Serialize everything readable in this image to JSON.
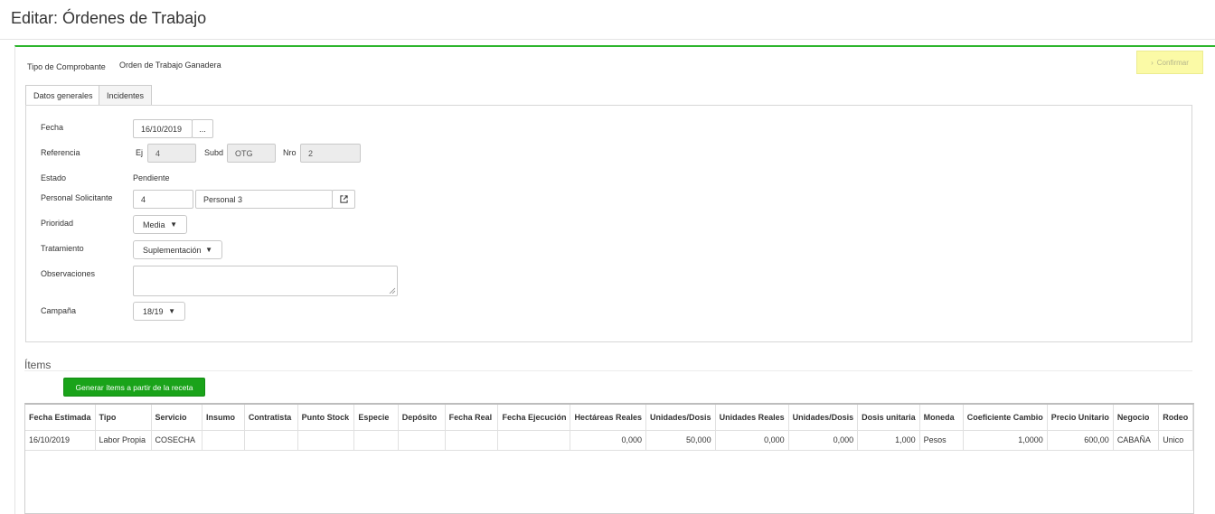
{
  "header": {
    "title": "Editar: Órdenes de Trabajo"
  },
  "form": {
    "tipo_label": "Tipo de Comprobante",
    "tipo_value": "Orden de Trabajo Ganadera",
    "confirm_label": "Confirmar",
    "tabs": [
      {
        "label": "Datos generales"
      },
      {
        "label": "Incidentes"
      }
    ],
    "fecha_label": "Fecha",
    "fecha_value": "16/10/2019",
    "fecha_btn": "...",
    "referencia_label": "Referencia",
    "ej_label": "Ej",
    "ej_value": "4",
    "subd_label": "Subd",
    "subd_value": "OTG",
    "nro_label": "Nro",
    "nro_value": "2",
    "estado_label": "Estado",
    "estado_value": "Pendiente",
    "personal_label": "Personal Solicitante",
    "personal_code": "4",
    "personal_name": "Personal 3",
    "prioridad_label": "Prioridad",
    "prioridad_value": "Media",
    "tratamiento_label": "Tratamiento",
    "tratamiento_value": "Suplementación",
    "observaciones_label": "Observaciones",
    "observaciones_value": "",
    "campana_label": "Campaña",
    "campana_value": "18/19"
  },
  "items": {
    "title": "Ítems",
    "generate_label": "Generar ítems a partir de la receta",
    "columns": [
      "Fecha Estimada",
      "Tipo",
      "Servicio",
      "Insumo",
      "Contratista",
      "Punto Stock",
      "Especie",
      "Depósito",
      "Fecha Real",
      "Fecha Ejecución",
      "Hectáreas Reales",
      "Unidades/Dosis",
      "Unidades Reales",
      "Unidades/Dosis",
      "Dosis unitaria",
      "Moneda",
      "Coeficiente Cambio",
      "Precio Unitario",
      "Negocio",
      "Rodeo"
    ],
    "rows": [
      [
        "16/10/2019",
        "Labor Propia",
        "COSECHA",
        "",
        "",
        "",
        "",
        "",
        "",
        "",
        "0,000",
        "50,000",
        "0,000",
        "0,000",
        "1,000",
        "Pesos",
        "1,0000",
        "600,00",
        "CABAÑA",
        "Unico"
      ]
    ]
  },
  "colors": {
    "accent": "#2db52d",
    "button_green": "#1aa31a",
    "confirm_bg": "#fbfaa6"
  }
}
